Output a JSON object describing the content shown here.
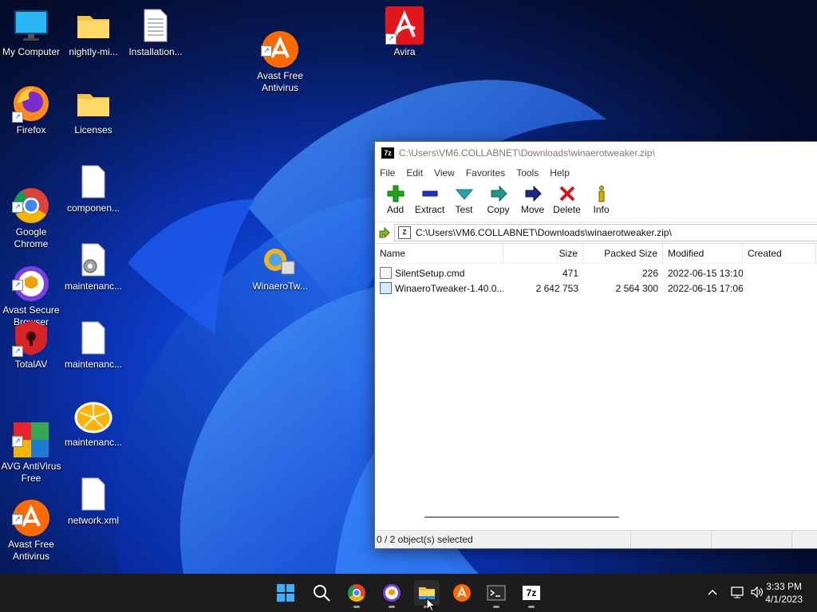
{
  "desktop": {
    "icons": [
      {
        "label": "My Computer"
      },
      {
        "label": "nightly-mi..."
      },
      {
        "label": "Installation..."
      },
      {
        "label": "Avast Free\nAntivirus"
      },
      {
        "label": "Avira"
      },
      {
        "label": "Firefox"
      },
      {
        "label": "Licenses"
      },
      {
        "label": "Google\nChrome"
      },
      {
        "label": "componen..."
      },
      {
        "label": "WinaeroTw..."
      },
      {
        "label": "Avast Secure\nBrowser"
      },
      {
        "label": "maintenanc..."
      },
      {
        "label": "TotalAV"
      },
      {
        "label": "maintenanc..."
      },
      {
        "label": "AVG AntiVirus\nFree"
      },
      {
        "label": "maintenanc..."
      },
      {
        "label": "Avast Free\nAntivirus"
      },
      {
        "label": "network.xml"
      }
    ]
  },
  "window": {
    "title": "C:\\Users\\VM6.COLLABNET\\Downloads\\winaerotweaker.zip\\",
    "app_icon": "7z",
    "menu": [
      "File",
      "Edit",
      "View",
      "Favorites",
      "Tools",
      "Help"
    ],
    "toolbar": [
      {
        "label": "Add",
        "icon": "plus-icon",
        "color": "#1aa51a"
      },
      {
        "label": "Extract",
        "icon": "minus-icon",
        "color": "#1a35c8"
      },
      {
        "label": "Test",
        "icon": "check-icon",
        "color": "#1fa8b0"
      },
      {
        "label": "Copy",
        "icon": "copy-arrow-icon",
        "color": "#1a9a8a"
      },
      {
        "label": "Move",
        "icon": "move-arrow-icon",
        "color": "#1a2a8a"
      },
      {
        "label": "Delete",
        "icon": "x-icon",
        "color": "#d01818"
      },
      {
        "label": "Info",
        "icon": "info-icon",
        "color": "#c9b400"
      }
    ],
    "address": "C:\\Users\\VM6.COLLABNET\\Downloads\\winaerotweaker.zip\\",
    "columns": [
      "Name",
      "Size",
      "Packed Size",
      "Modified",
      "Created"
    ],
    "rows": [
      {
        "name": "SilentSetup.cmd",
        "size": "471",
        "packed": "226",
        "modified": "2022-06-15 13:10",
        "created": ""
      },
      {
        "name": "WinaeroTweaker-1.40.0....",
        "size": "2 642 753",
        "packed": "2 564 300",
        "modified": "2022-06-15 17:06",
        "created": ""
      }
    ],
    "status": "0 / 2 object(s) selected"
  },
  "taskbar": {
    "time": "3:33 PM",
    "date": "4/1/2023",
    "apps": [
      "start",
      "search",
      "chrome",
      "avast-secure-browser",
      "file-explorer",
      "avast",
      "terminal",
      "7zip"
    ],
    "sevenzip_label": "7z"
  }
}
